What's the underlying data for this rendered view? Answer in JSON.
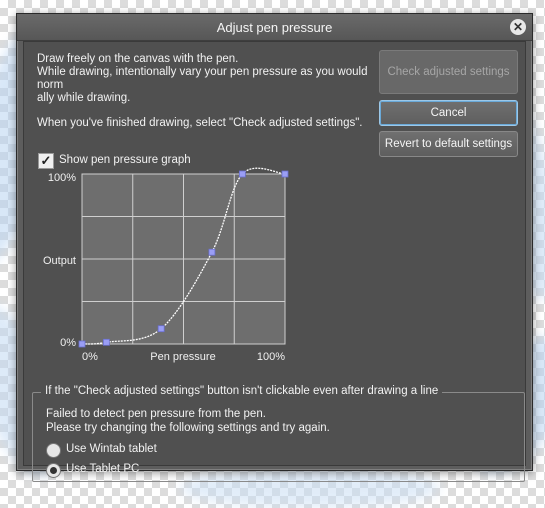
{
  "dialog": {
    "title": "Adjust pen pressure",
    "instructions": {
      "line1": "Draw freely on the canvas with the pen.",
      "line2": "While drawing, intentionally vary your pen pressure as you would norm",
      "line3": "ally while drawing.",
      "line4": "When you've finished drawing, select \"Check adjusted settings\"."
    },
    "buttons": {
      "check_adjusted": "Check adjusted settings",
      "cancel": "Cancel",
      "revert": "Revert to default settings"
    },
    "show_graph": {
      "label": "Show pen pressure graph",
      "checked": true
    },
    "graph": {
      "y_top_label": "100%",
      "y_mid_label": "Output",
      "y_bottom_label": "0%",
      "x_left_label": "0%",
      "x_mid_label": "Pen pressure",
      "x_right_label": "100%",
      "control_points": [
        {
          "input": 0,
          "output": 0
        },
        {
          "input": 0.12,
          "output": 0.01
        },
        {
          "input": 0.39,
          "output": 0.09
        },
        {
          "input": 0.64,
          "output": 0.54
        },
        {
          "input": 0.79,
          "output": 1.0
        },
        {
          "input": 1.0,
          "output": 1.0
        }
      ]
    },
    "troubleshoot": {
      "legend": "If the \"Check adjusted settings\" button isn't clickable even after drawing a line",
      "message1": "Failed to detect pen pressure from the pen.",
      "message2": "Please try changing the following settings and try again.",
      "options": [
        {
          "label": "Use Wintab tablet",
          "selected": false
        },
        {
          "label": "Use Tablet PC",
          "selected": true
        }
      ]
    }
  },
  "colors": {
    "dialog_bg": "#5d5d5d",
    "curve": "#ffffff",
    "control_point": "#9a9ef5",
    "focus_accent": "#9cc8e8"
  }
}
